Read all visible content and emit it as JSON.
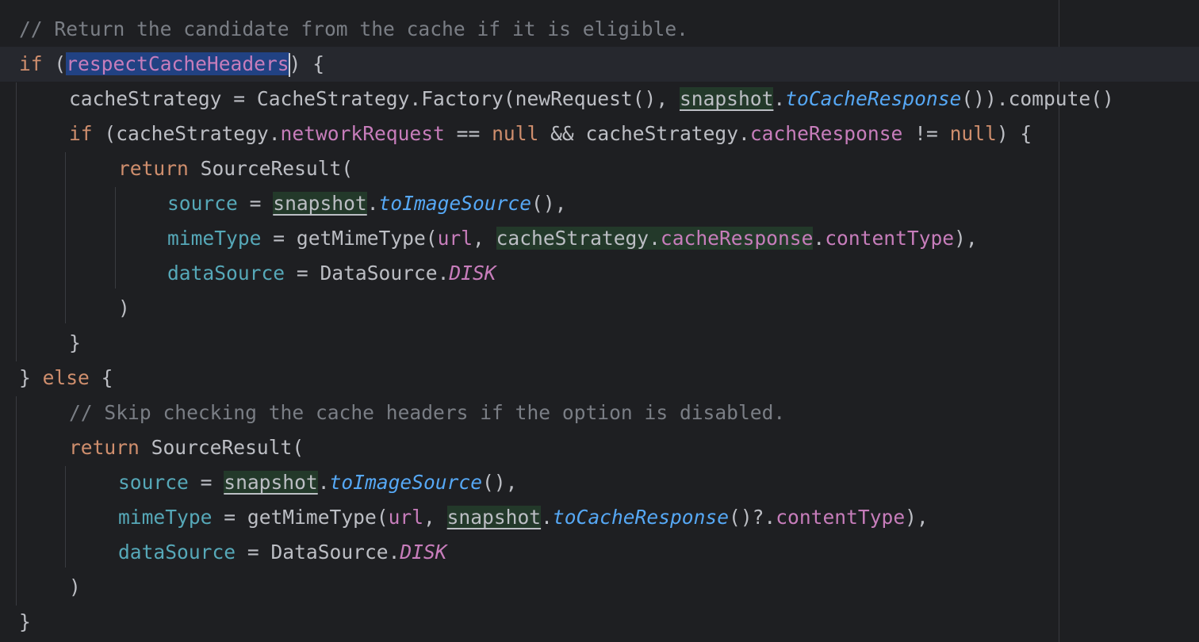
{
  "editor": {
    "lines": [
      {
        "segments": [
          {
            "t": "// Return the candidate from the cache if it is eligible.",
            "c": "cm"
          }
        ]
      },
      {
        "segments": [
          {
            "t": "if",
            "c": "kw"
          },
          {
            "t": " ("
          },
          {
            "t": "respectCacheHeaders",
            "c": "sel"
          },
          {
            "caret": true
          },
          {
            "t": ") {"
          }
        ]
      },
      {
        "segments": [
          {
            "t": "cacheStrategy = CacheStrategy.Factory(newRequest(), "
          },
          {
            "t": "snapshot",
            "c": "smart"
          },
          {
            "t": "."
          },
          {
            "t": "toCacheResponse",
            "c": "fn-ital"
          },
          {
            "t": "()).compute()"
          }
        ]
      },
      {
        "segments": [
          {
            "t": "if",
            "c": "kw"
          },
          {
            "t": " (cacheStrategy."
          },
          {
            "t": "networkRequest",
            "c": "prop"
          },
          {
            "t": " == "
          },
          {
            "t": "null",
            "c": "kw"
          },
          {
            "t": " && cacheStrategy."
          },
          {
            "t": "cacheResponse",
            "c": "prop"
          },
          {
            "t": " != "
          },
          {
            "t": "null",
            "c": "kw"
          },
          {
            "t": ") {"
          }
        ]
      },
      {
        "segments": [
          {
            "t": "return",
            "c": "kw"
          },
          {
            "t": " SourceResult("
          }
        ]
      },
      {
        "segments": [
          {
            "t": "source",
            "c": "param"
          },
          {
            "t": " = "
          },
          {
            "t": "snapshot",
            "c": "smart"
          },
          {
            "t": "."
          },
          {
            "t": "toImageSource",
            "c": "fn-ital"
          },
          {
            "t": "(),"
          }
        ]
      },
      {
        "segments": [
          {
            "t": "mimeType",
            "c": "param"
          },
          {
            "t": " = getMimeType("
          },
          {
            "t": "url",
            "c": "prop"
          },
          {
            "t": ", "
          },
          {
            "t": "cacheStrategy.",
            "c": "smartbox"
          },
          {
            "t": "cacheResponse",
            "c": "prop smartbox"
          },
          {
            "t": "."
          },
          {
            "t": "contentType",
            "c": "prop"
          },
          {
            "t": "),"
          }
        ]
      },
      {
        "segments": [
          {
            "t": "dataSource",
            "c": "param"
          },
          {
            "t": " = DataSource."
          },
          {
            "t": "DISK",
            "c": "const"
          }
        ]
      },
      {
        "segments": [
          {
            "t": ")"
          }
        ]
      },
      {
        "segments": [
          {
            "t": "}"
          }
        ]
      },
      {
        "segments": [
          {
            "t": "} "
          },
          {
            "t": "else",
            "c": "kw"
          },
          {
            "t": " {"
          }
        ]
      },
      {
        "segments": [
          {
            "t": "// Skip checking the cache headers if the option is disabled.",
            "c": "cm"
          }
        ]
      },
      {
        "segments": [
          {
            "t": "return",
            "c": "kw"
          },
          {
            "t": " SourceResult("
          }
        ]
      },
      {
        "segments": [
          {
            "t": "source",
            "c": "param"
          },
          {
            "t": " = "
          },
          {
            "t": "snapshot",
            "c": "smart"
          },
          {
            "t": "."
          },
          {
            "t": "toImageSource",
            "c": "fn-ital"
          },
          {
            "t": "(),"
          }
        ]
      },
      {
        "segments": [
          {
            "t": "mimeType",
            "c": "param"
          },
          {
            "t": " = getMimeType("
          },
          {
            "t": "url",
            "c": "prop"
          },
          {
            "t": ", "
          },
          {
            "t": "snapshot",
            "c": "smart"
          },
          {
            "t": "."
          },
          {
            "t": "toCacheResponse",
            "c": "fn-ital"
          },
          {
            "t": "()?."
          },
          {
            "t": "contentType",
            "c": "prop"
          },
          {
            "t": "),"
          }
        ]
      },
      {
        "segments": [
          {
            "t": "dataSource",
            "c": "param"
          },
          {
            "t": " = DataSource."
          },
          {
            "t": "DISK",
            "c": "const"
          }
        ]
      },
      {
        "segments": [
          {
            "t": ")"
          }
        ]
      },
      {
        "segments": [
          {
            "t": "}"
          }
        ]
      }
    ]
  }
}
